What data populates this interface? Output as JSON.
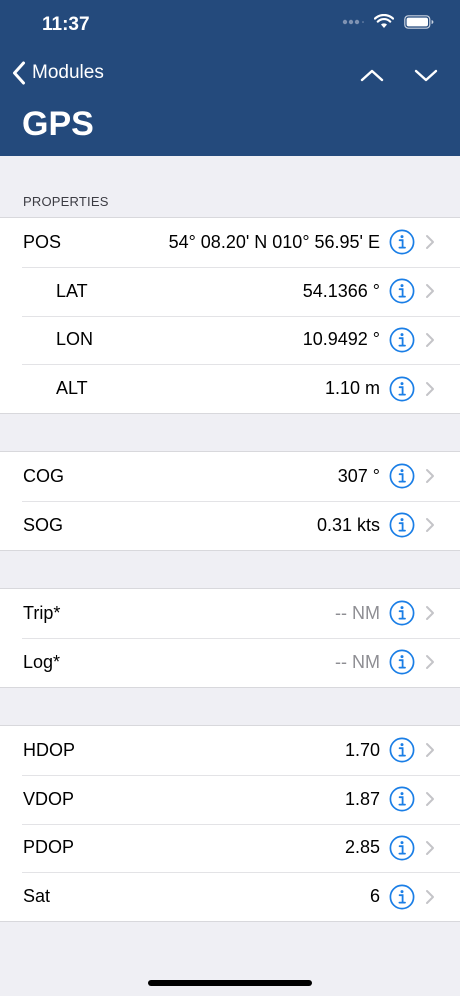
{
  "status_bar": {
    "time": "11:37"
  },
  "nav": {
    "back_label": "Modules"
  },
  "title": "GPS",
  "sections": {
    "properties_header": "PROPERTIES"
  },
  "groups": [
    {
      "rows": [
        {
          "label": "POS",
          "value": "54° 08.20' N 010° 56.95' E",
          "indent": false,
          "muted": false
        },
        {
          "label": "LAT",
          "value": "54.1366 °",
          "indent": true,
          "muted": false
        },
        {
          "label": "LON",
          "value": "10.9492 °",
          "indent": true,
          "muted": false
        },
        {
          "label": "ALT",
          "value": "1.10 m",
          "indent": true,
          "muted": false
        }
      ]
    },
    {
      "rows": [
        {
          "label": "COG",
          "value": "307 °",
          "indent": false,
          "muted": false
        },
        {
          "label": "SOG",
          "value": "0.31 kts",
          "indent": false,
          "muted": false
        }
      ]
    },
    {
      "rows": [
        {
          "label": "Trip*",
          "value": "-- NM",
          "indent": false,
          "muted": true
        },
        {
          "label": "Log*",
          "value": "-- NM",
          "indent": false,
          "muted": true
        }
      ]
    },
    {
      "rows": [
        {
          "label": "HDOP",
          "value": "1.70",
          "indent": false,
          "muted": false
        },
        {
          "label": "VDOP",
          "value": "1.87",
          "indent": false,
          "muted": false
        },
        {
          "label": "PDOP",
          "value": "2.85",
          "indent": false,
          "muted": false
        },
        {
          "label": "Sat",
          "value": "6",
          "indent": false,
          "muted": false
        }
      ]
    }
  ],
  "colors": {
    "header_bg": "#244a7c",
    "accent": "#1a7ee6",
    "chevron": "#c4c4c8"
  }
}
